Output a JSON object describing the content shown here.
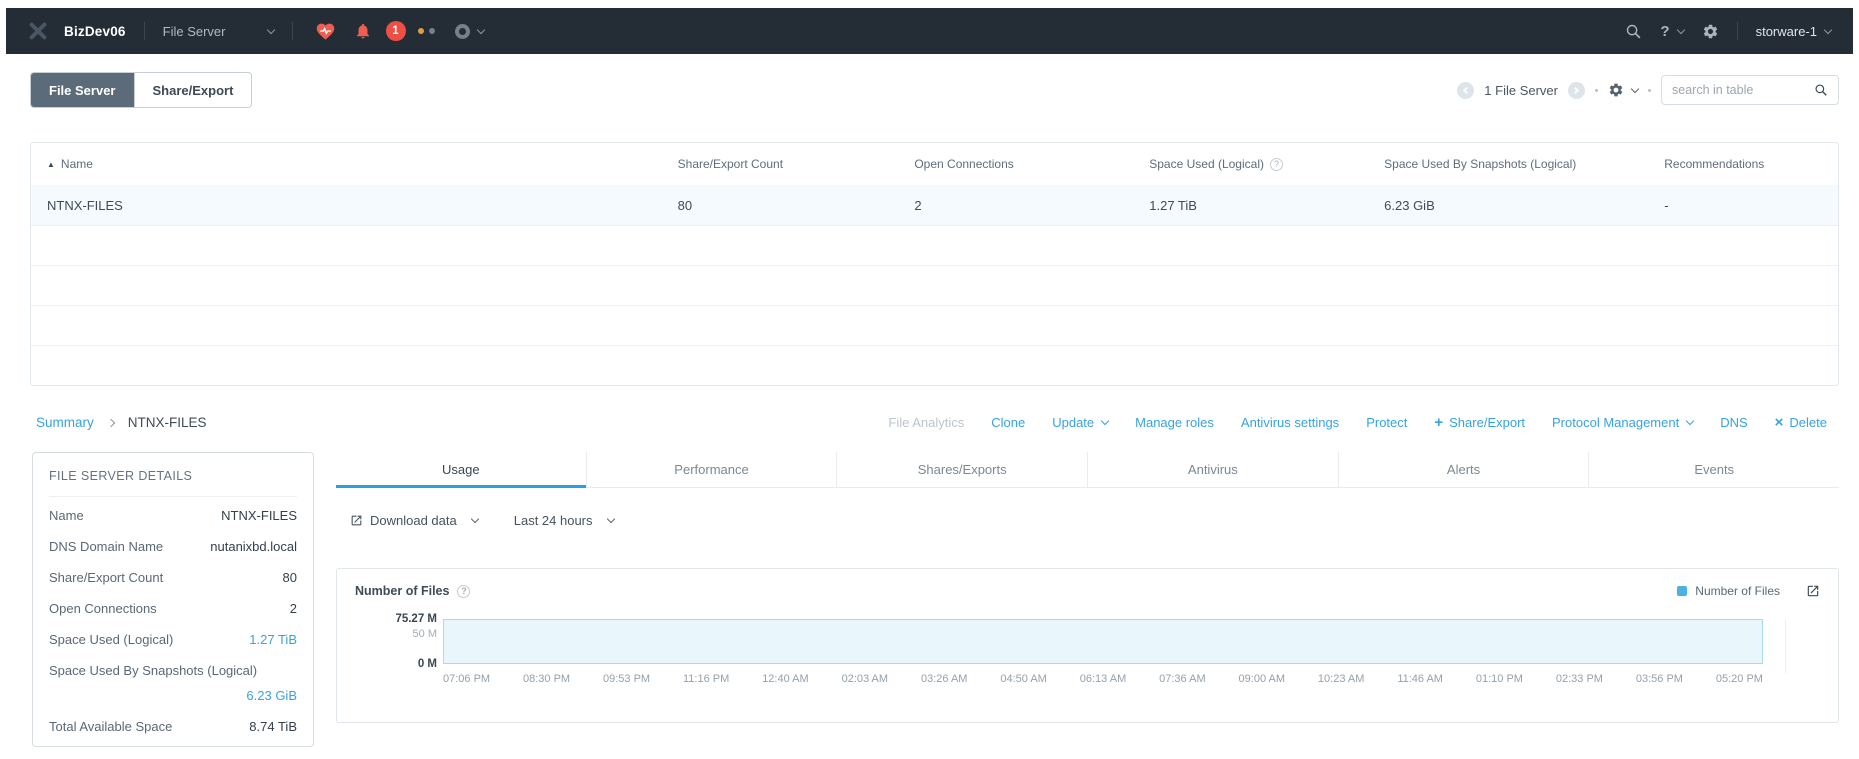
{
  "nav": {
    "brand": "BizDev06",
    "menu": "File Server",
    "alert_count": "1",
    "help": "?",
    "user": "storware-1"
  },
  "toolbar": {
    "tabs": [
      {
        "label": "File Server"
      },
      {
        "label": "Share/Export"
      }
    ],
    "count_label": "1 File Server",
    "search_placeholder": "search in table"
  },
  "table": {
    "columns": [
      {
        "label": "Name"
      },
      {
        "label": "Share/Export Count"
      },
      {
        "label": "Open Connections"
      },
      {
        "label": "Space Used (Logical)"
      },
      {
        "label": "Space Used By Snapshots (Logical)"
      },
      {
        "label": "Recommendations"
      }
    ],
    "rows": [
      [
        "NTNX-FILES",
        "80",
        "2",
        "1.27 TiB",
        "6.23 GiB",
        "-"
      ]
    ]
  },
  "breadcrumb": {
    "root": "Summary",
    "current": "NTNX-FILES"
  },
  "actions": [
    {
      "label": "File Analytics"
    },
    {
      "label": "Clone"
    },
    {
      "label": "Update"
    },
    {
      "label": "Manage roles"
    },
    {
      "label": "Antivirus settings"
    },
    {
      "label": "Protect"
    },
    {
      "label": "Share/Export"
    },
    {
      "label": "Protocol Management"
    },
    {
      "label": "DNS"
    },
    {
      "label": "Delete"
    }
  ],
  "details": {
    "title": "FILE SERVER DETAILS",
    "rows": [
      {
        "label": "Name",
        "value": "NTNX-FILES"
      },
      {
        "label": "DNS Domain Name",
        "value": "nutanixbd.local"
      },
      {
        "label": "Share/Export Count",
        "value": "80"
      },
      {
        "label": "Open Connections",
        "value": "2"
      },
      {
        "label": "Space Used (Logical)",
        "value": "1.27 TiB"
      },
      {
        "label": "Space Used By Snapshots (Logical)",
        "value": "6.23 GiB"
      },
      {
        "label": "Total Available Space",
        "value": "8.74 TiB"
      }
    ]
  },
  "content": {
    "tabs": [
      {
        "label": "Usage"
      },
      {
        "label": "Performance"
      },
      {
        "label": "Shares/Exports"
      },
      {
        "label": "Antivirus"
      },
      {
        "label": "Alerts"
      },
      {
        "label": "Events"
      }
    ],
    "download_label": "Download data",
    "range_label": "Last 24 hours"
  },
  "chart_data": {
    "type": "area",
    "title": "Number of Files",
    "legend": [
      "Number of Files"
    ],
    "legend_position": "top-right",
    "unit": "M",
    "ylim": [
      0,
      75.27
    ],
    "yticks": [
      "75.27 M",
      "50 M",
      "0 M"
    ],
    "grid": false,
    "x": [
      "07:06 PM",
      "08:30 PM",
      "09:53 PM",
      "11:16 PM",
      "12:40 AM",
      "02:03 AM",
      "03:26 AM",
      "04:50 AM",
      "06:13 AM",
      "07:36 AM",
      "09:00 AM",
      "10:23 AM",
      "11:46 AM",
      "01:10 PM",
      "02:33 PM",
      "03:56 PM",
      "05:20 PM"
    ],
    "series": [
      {
        "name": "Number of Files",
        "values": [
          75.27,
          75.27,
          75.27,
          75.27,
          75.27,
          75.27,
          75.27,
          75.27,
          75.27,
          75.27,
          75.27,
          75.27,
          75.27,
          75.27,
          75.27,
          75.27,
          75.27
        ]
      }
    ]
  }
}
